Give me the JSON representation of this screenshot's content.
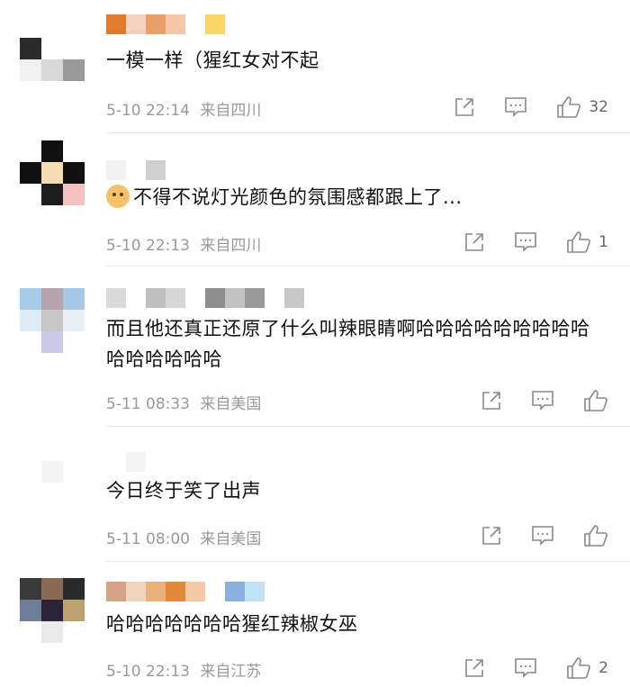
{
  "comments": [
    {
      "text": "一模一样（猩红女对不起",
      "time": "5-10 22:14",
      "location": "来自四川",
      "likes": "32",
      "avatar_colors": [
        "#ffffff",
        "#ffffff",
        "#ffffff",
        "#2b2b2b",
        "#ffffff",
        "#ffffff",
        "#f0f0f0",
        "#d8d8d8",
        "#9a9a9a"
      ],
      "name_colors": [
        "#e07a2e",
        "#f3d2c0",
        "#e9a06a",
        "#f5c6a8",
        "#ffffff",
        "#f8d66a"
      ]
    },
    {
      "text": "不得不说灯光颜色的氛围感都跟上了...",
      "time": "5-10 22:13",
      "location": "来自四川",
      "likes": "1",
      "avatar_colors": [
        "#ffffff",
        "#111111",
        "#ffffff",
        "#111111",
        "#f6dcb4",
        "#111111",
        "#ffffff",
        "#1e1e1e",
        "#f4c0c0"
      ],
      "name_colors": [
        "#f2f2f2",
        "#ffffff",
        "#cfcfcf"
      ]
    },
    {
      "text": "而且他还真正还原了什么叫辣眼睛啊哈哈哈哈哈哈哈哈哈哈哈哈哈哈哈",
      "time": "5-11 08:33",
      "location": "来自美国",
      "likes": "",
      "avatar_colors": [
        "#a8cdea",
        "#b8a3ad",
        "#a7c7e4",
        "#dde9f3",
        "#c6c6c6",
        "#e8eef3",
        "#ffffff",
        "#c9c9e6",
        "#ffffff"
      ],
      "name_colors": [
        "#d9d9d9",
        "#ffffff",
        "#bfbfbf",
        "#d6d6d6",
        "#ffffff",
        "#8e8e8e",
        "#c2c2c2",
        "#9a9a9a",
        "#ffffff",
        "#c8c8c8"
      ]
    },
    {
      "text": "今日终于笑了出声",
      "time": "5-11 08:00",
      "location": "来自美国",
      "likes": "",
      "avatar_colors": [
        "#ffffff",
        "#ffffff",
        "#ffffff",
        "#ffffff",
        "#f4f4f4",
        "#ffffff",
        "#ffffff",
        "#ffffff",
        "#ffffff"
      ],
      "name_colors": [
        "#ffffff",
        "#f4f4f4",
        "#ffffff"
      ]
    },
    {
      "text": "哈哈哈哈哈哈哈猩红辣椒女巫",
      "time": "5-10 22:13",
      "location": "来自江苏",
      "likes": "2",
      "avatar_colors": [
        "#3a3a3a",
        "#8a6a52",
        "#2a2a2a",
        "#6c7d96",
        "#2b2438",
        "#bba36f",
        "#ffffff",
        "#eaeaea",
        "#ffffff"
      ],
      "name_colors": [
        "#d7a386",
        "#f1d4bd",
        "#e9b07a",
        "#e3893a",
        "#f6c9a8",
        "#ffffff",
        "#8bb0e0",
        "#bfe3f2"
      ]
    }
  ],
  "icons": [
    "share-icon",
    "comment-icon",
    "like-icon"
  ]
}
